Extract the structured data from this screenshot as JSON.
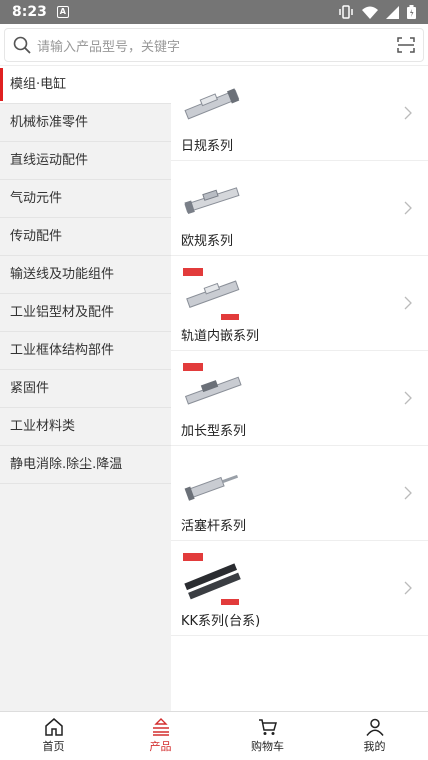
{
  "status": {
    "time": "8:23",
    "a_badge": "A"
  },
  "search": {
    "placeholder": "请输入产品型号，关键字"
  },
  "sidebar": {
    "items": [
      {
        "label": "模组·电缸"
      },
      {
        "label": "机械标准零件"
      },
      {
        "label": "直线运动配件"
      },
      {
        "label": "气动元件"
      },
      {
        "label": "传动配件"
      },
      {
        "label": "输送线及功能组件"
      },
      {
        "label": "工业铝型材及配件"
      },
      {
        "label": "工业框体结构部件"
      },
      {
        "label": "紧固件"
      },
      {
        "label": "工业材料类"
      },
      {
        "label": "静电消除.除尘.降温"
      }
    ]
  },
  "products": [
    {
      "name": "日规系列"
    },
    {
      "name": "欧规系列"
    },
    {
      "name": "轨道内嵌系列"
    },
    {
      "name": "加长型系列"
    },
    {
      "name": "活塞杆系列"
    },
    {
      "name": "KK系列(台系)"
    }
  ],
  "tabbar": {
    "tabs": [
      {
        "label": "首页",
        "icon": "home-icon"
      },
      {
        "label": "产品",
        "icon": "product-icon"
      },
      {
        "label": "购物车",
        "icon": "cart-icon"
      },
      {
        "label": "我的",
        "icon": "user-icon"
      }
    ]
  },
  "colors": {
    "accent": "#d32f2f",
    "sidebar_bg": "#f2f2f2",
    "statusbar": "#757575"
  }
}
